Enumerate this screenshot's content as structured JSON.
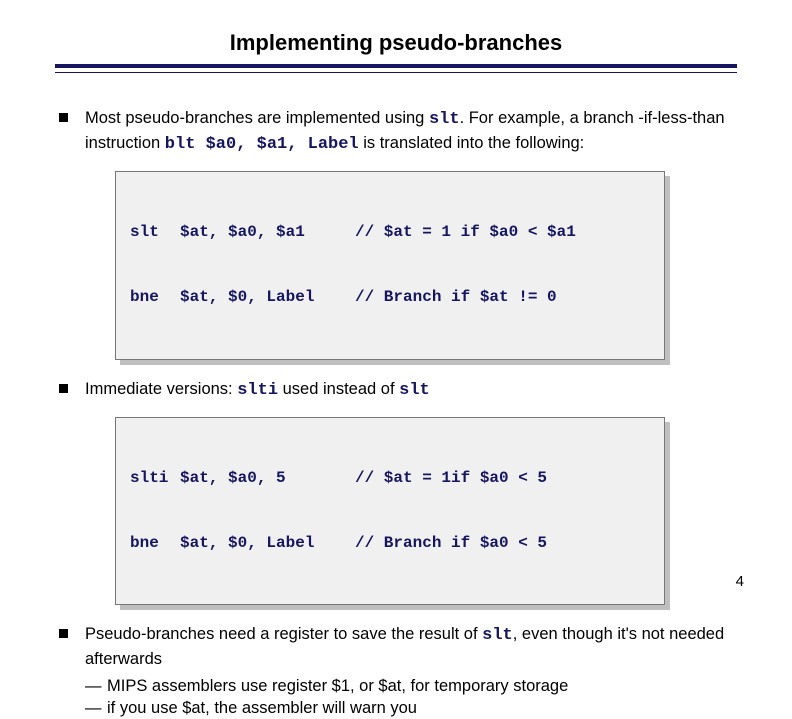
{
  "title": "Implementing pseudo-branches",
  "bullets": {
    "b1_prefix": "Most pseudo-branches are implemented using ",
    "b1_slt": "slt",
    "b1_mid": ". For example, a branch -if-less-than instruction ",
    "b1_blt": "blt $a0, $a1, Label",
    "b1_suffix": " is translated into the following:",
    "b2_prefix": "Immediate versions: ",
    "b2_slti": "slti",
    "b2_mid": " used instead of ",
    "b2_slt": "slt",
    "b3_prefix": "Pseudo-branches need a register to save the result of ",
    "b3_slt": "slt",
    "b3_suffix": ", even though it's not needed afterwards",
    "sub1": "MIPS assemblers use register $1, or $at, for temporary storage",
    "sub2": "if you use $at, the assembler will warn you"
  },
  "code1": {
    "l1_op": "slt",
    "l1_args": "$at, $a0, $a1",
    "l1_cmt": "// $at = 1 if $a0 < $a1",
    "l2_op": "bne",
    "l2_args": "$at, $0, Label",
    "l2_cmt": "// Branch if $at != 0"
  },
  "code2": {
    "l1_op": "slti",
    "l1_args": "$at, $a0, 5",
    "l1_cmt": "// $at = 1if $a0 < 5",
    "l2_op": "bne",
    "l2_args": "$at, $0, Label",
    "l2_cmt": "// Branch if $a0 < 5"
  },
  "pagenum": "4"
}
